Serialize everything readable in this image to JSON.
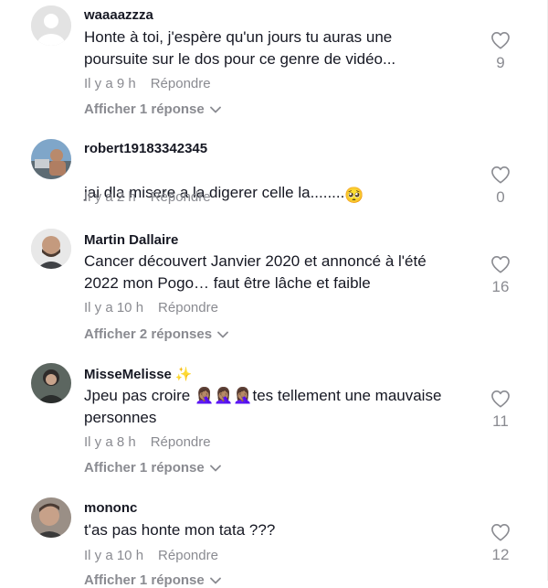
{
  "comments": [
    {
      "username": "waaaazzza",
      "text": "Honte à toi, j'espère qu'un jours tu auras une\npoursuite sur le dos pour ce genre de vidéo...",
      "time": "Il y a 9 h",
      "reply_label": "Répondre",
      "likes": "9",
      "view_replies": "Afficher 1 réponse"
    },
    {
      "username": "robert19183342345",
      "text": "jai dla misere a la digerer celle la........",
      "emoji": "🥺",
      "time": "Il y a 2 h",
      "reply_label": "Répondre",
      "likes": "0"
    },
    {
      "username": "Martin Dallaire",
      "text": "Cancer découvert Janvier 2020 et annoncé à l'été\n2022 mon Pogo… faut être lâche et faible",
      "time": "Il y a 10 h",
      "reply_label": "Répondre",
      "likes": "16",
      "view_replies": "Afficher 2 réponses"
    },
    {
      "username": "MisseMelisse",
      "username_emoji": "✨",
      "text_prefix": "Jpeu pas croire ",
      "text_emojis": "🤦🏽‍♀️🤦🏽‍♀️🤦🏽‍♀️",
      "text_suffix": "tes tellement une mauvaise\npersonnes",
      "time": "Il y a 8 h",
      "reply_label": "Répondre",
      "likes": "11",
      "view_replies": "Afficher 1 réponse"
    },
    {
      "username": "mononc",
      "text": "t'as pas honte mon tata ???",
      "time": "Il y a 10 h",
      "reply_label": "Répondre",
      "likes": "12",
      "view_replies": "Afficher 1 réponse"
    }
  ],
  "colors": {
    "text": "#161823",
    "muted": "#8a8b91",
    "avatar_placeholder": "#dcdcdc"
  },
  "icons": {
    "like": "heart-outline-icon",
    "expand": "chevron-down-icon"
  }
}
